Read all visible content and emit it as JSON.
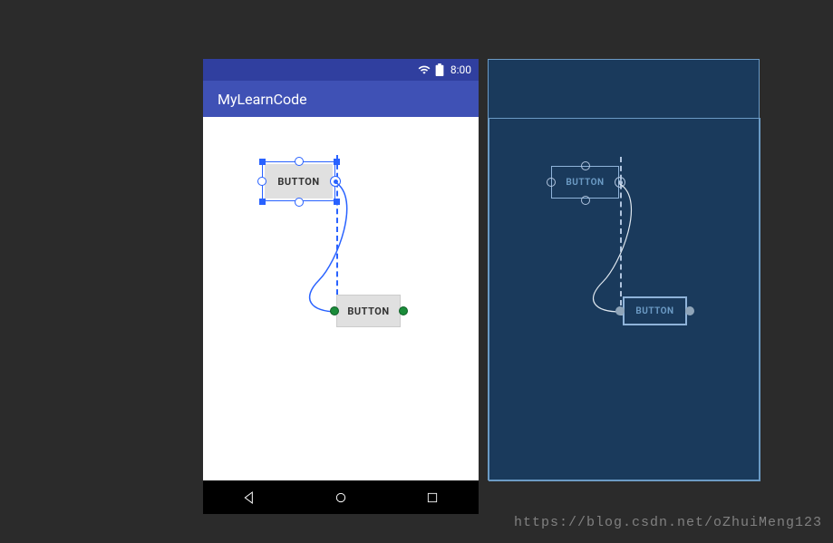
{
  "status": {
    "time": "8:00"
  },
  "appbar": {
    "title": "MyLearnCode"
  },
  "preview": {
    "button1_label": "BUTTON",
    "button2_label": "BUTTON"
  },
  "blueprint": {
    "button1_label": "BUTTON",
    "button2_label": "BUTTON"
  },
  "watermark": {
    "text": "https://blog.csdn.net/oZhuiMeng123"
  }
}
